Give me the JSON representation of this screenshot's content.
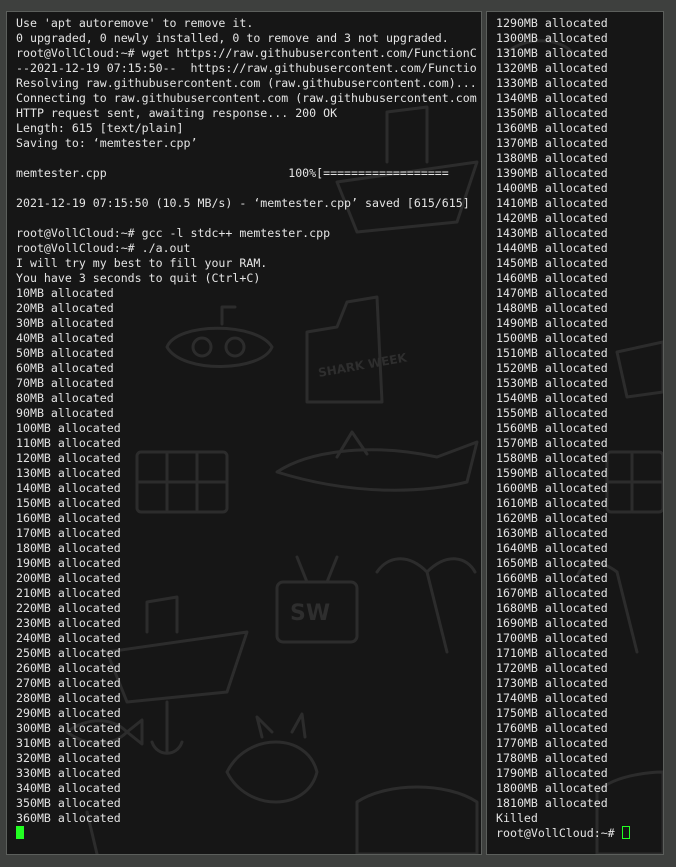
{
  "colors": {
    "background": "#3e403e",
    "terminal_bg": "#161616",
    "text": "#e4e4e4",
    "cursor": "#22ff22",
    "doodle_stroke": "#2c2c2c"
  },
  "left_terminal": {
    "lines": [
      "Use 'apt autoremove' to remove it.",
      "0 upgraded, 0 newly installed, 0 to remove and 3 not upgraded.",
      "root@VollCloud:~# wget https://raw.githubusercontent.com/FunctionC",
      "--2021-12-19 07:15:50--  https://raw.githubusercontent.com/Functio",
      "Resolving raw.githubusercontent.com (raw.githubusercontent.com)...",
      "Connecting to raw.githubusercontent.com (raw.githubusercontent.com",
      "HTTP request sent, awaiting response... 200 OK",
      "Length: 615 [text/plain]",
      "Saving to: ‘memtester.cpp’",
      "",
      "memtester.cpp                          100%[==================",
      "",
      "2021-12-19 07:15:50 (10.5 MB/s) - ‘memtester.cpp’ saved [615/615]",
      "",
      "root@VollCloud:~# gcc -l stdc++ memtester.cpp",
      "root@VollCloud:~# ./a.out",
      "I will try my best to fill your RAM.",
      "You have 3 seconds to quit (Ctrl+C)",
      "10MB allocated",
      "20MB allocated",
      "30MB allocated",
      "40MB allocated",
      "50MB allocated",
      "60MB allocated",
      "70MB allocated",
      "80MB allocated",
      "90MB allocated",
      "100MB allocated",
      "110MB allocated",
      "120MB allocated",
      "130MB allocated",
      "140MB allocated",
      "150MB allocated",
      "160MB allocated",
      "170MB allocated",
      "180MB allocated",
      "190MB allocated",
      "200MB allocated",
      "210MB allocated",
      "220MB allocated",
      "230MB allocated",
      "240MB allocated",
      "250MB allocated",
      "260MB allocated",
      "270MB allocated",
      "280MB allocated",
      "290MB allocated",
      "300MB allocated",
      "310MB allocated",
      "320MB allocated",
      "330MB allocated",
      "340MB allocated",
      "350MB allocated",
      "360MB allocated"
    ]
  },
  "right_terminal": {
    "lines": [
      "1290MB allocated",
      "1300MB allocated",
      "1310MB allocated",
      "1320MB allocated",
      "1330MB allocated",
      "1340MB allocated",
      "1350MB allocated",
      "1360MB allocated",
      "1370MB allocated",
      "1380MB allocated",
      "1390MB allocated",
      "1400MB allocated",
      "1410MB allocated",
      "1420MB allocated",
      "1430MB allocated",
      "1440MB allocated",
      "1450MB allocated",
      "1460MB allocated",
      "1470MB allocated",
      "1480MB allocated",
      "1490MB allocated",
      "1500MB allocated",
      "1510MB allocated",
      "1520MB allocated",
      "1530MB allocated",
      "1540MB allocated",
      "1550MB allocated",
      "1560MB allocated",
      "1570MB allocated",
      "1580MB allocated",
      "1590MB allocated",
      "1600MB allocated",
      "1610MB allocated",
      "1620MB allocated",
      "1630MB allocated",
      "1640MB allocated",
      "1650MB allocated",
      "1660MB allocated",
      "1670MB allocated",
      "1680MB allocated",
      "1690MB allocated",
      "1700MB allocated",
      "1710MB allocated",
      "1720MB allocated",
      "1730MB allocated",
      "1740MB allocated",
      "1750MB allocated",
      "1760MB allocated",
      "1770MB allocated",
      "1780MB allocated",
      "1790MB allocated",
      "1800MB allocated",
      "1810MB allocated",
      "Killed"
    ],
    "final_prompt": "root@VollCloud:~# "
  },
  "wallpaper": {
    "badge_text": "SHARK WEEK",
    "tv_text": "SW"
  }
}
